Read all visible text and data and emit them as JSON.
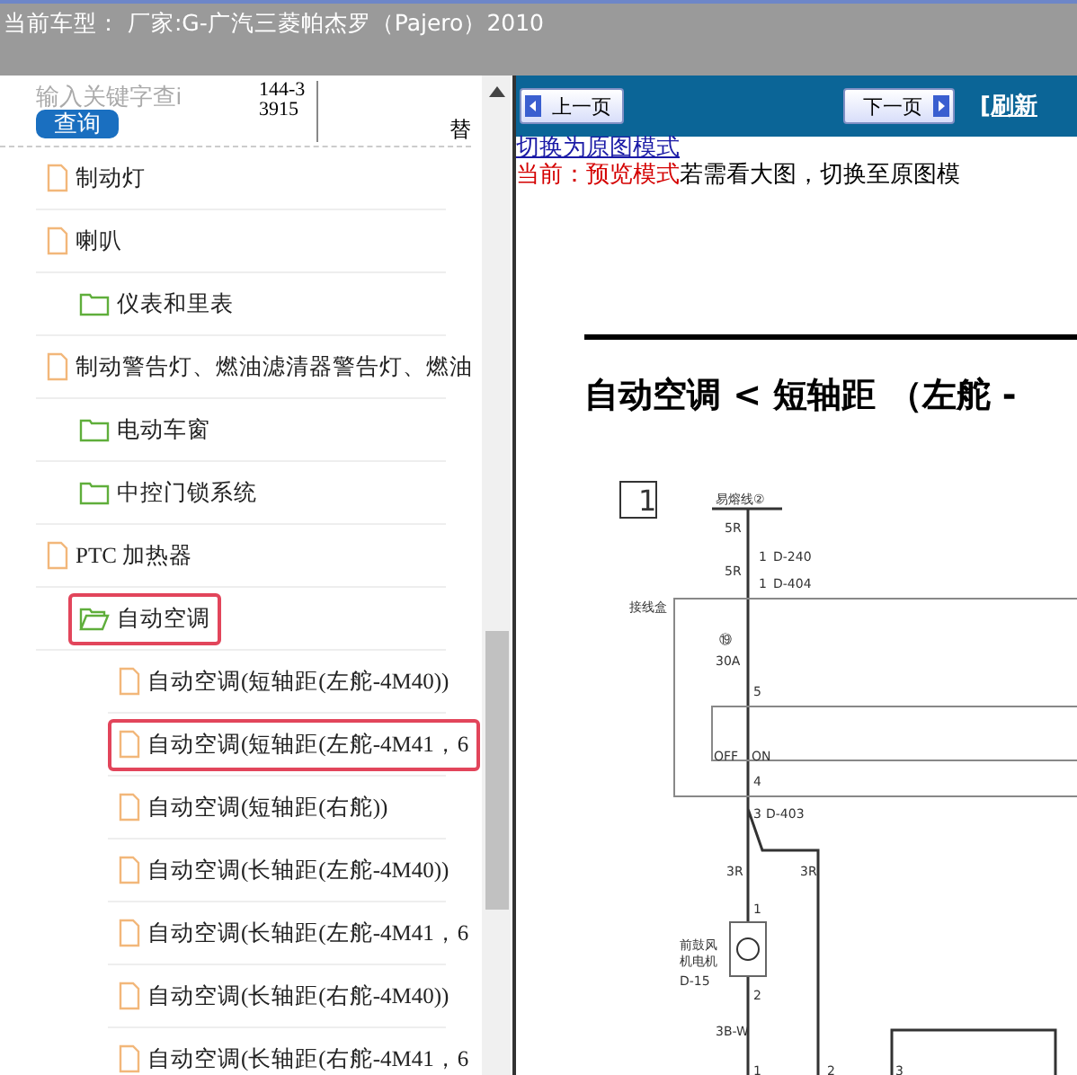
{
  "header": {
    "title": "当前车型： 厂家:G-广汽三菱帕杰罗（Pajero）2010"
  },
  "search": {
    "placeholder": "输入关键字查i",
    "button": "查询",
    "code": "144-33915",
    "side_text": "替"
  },
  "tree": [
    {
      "label": "制动灯",
      "kind": "file",
      "highlighted": false
    },
    {
      "label": "喇叭",
      "kind": "file",
      "highlighted": false
    },
    {
      "label": "仪表和里表",
      "kind": "folder",
      "expanded": false,
      "highlighted": false
    },
    {
      "label": "制动警告灯、燃油滤清器警告灯、燃油",
      "kind": "file",
      "highlighted": false
    },
    {
      "label": "电动车窗",
      "kind": "folder",
      "expanded": false,
      "highlighted": false
    },
    {
      "label": "中控门锁系统",
      "kind": "folder",
      "expanded": false,
      "highlighted": false
    },
    {
      "label": "PTC 加热器",
      "kind": "file",
      "highlighted": false
    },
    {
      "label": "自动空调",
      "kind": "folder",
      "expanded": true,
      "highlighted": true,
      "children": [
        {
          "label": "自动空调(短轴距(左舵-4M40))",
          "kind": "file",
          "highlighted": false
        },
        {
          "label": "自动空调(短轴距(左舵-4M41，6",
          "kind": "file",
          "highlighted": true
        },
        {
          "label": "自动空调(短轴距(右舵))",
          "kind": "file",
          "highlighted": false
        },
        {
          "label": "自动空调(长轴距(左舵-4M40))",
          "kind": "file",
          "highlighted": false
        },
        {
          "label": "自动空调(长轴距(左舵-4M41，6",
          "kind": "file",
          "highlighted": false
        },
        {
          "label": "自动空调(长轴距(右舵-4M40))",
          "kind": "file",
          "highlighted": false
        },
        {
          "label": "自动空调(长轴距(右舵-4M41，6",
          "kind": "file",
          "highlighted": false
        }
      ]
    }
  ],
  "nav": {
    "prev": "上一页",
    "next": "下一页",
    "refresh": "[刷新"
  },
  "mode": {
    "link": "切换为原图模式",
    "current": "当前：预览模式",
    "hint": "若需看大图，切换至原图模"
  },
  "document": {
    "title": "自动空调 < 短轴距 （左舵 -",
    "diagram_labels": [
      "1",
      "易熔线②",
      "5R",
      "1",
      "D-240",
      "5R",
      "1",
      "D-404",
      "接线盒",
      "⑲",
      "30A",
      "5",
      "OFF",
      "ON",
      "4",
      "3",
      "D-403",
      "3R",
      "3R",
      "1",
      "前鼓风",
      "机电机",
      "D-15",
      "2",
      "3B-W",
      "1",
      "2",
      "3"
    ]
  }
}
